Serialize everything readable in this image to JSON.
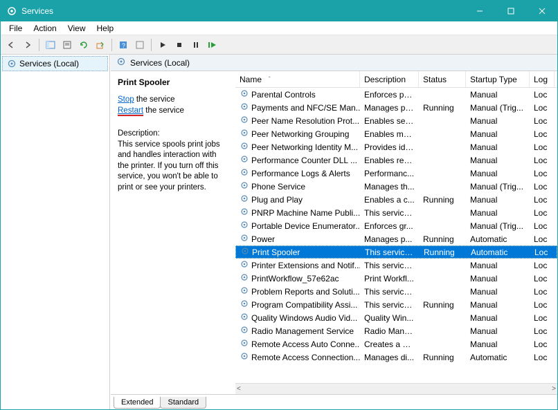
{
  "window": {
    "title": "Services"
  },
  "menubar": {
    "items": [
      "File",
      "Action",
      "View",
      "Help"
    ]
  },
  "tree": {
    "root": "Services (Local)"
  },
  "right_header": {
    "label": "Services (Local)"
  },
  "detail": {
    "title": "Print Spooler",
    "stop_link": "Stop",
    "stop_suffix": " the service",
    "restart_link": "Restart",
    "restart_suffix": " the service",
    "desc_label": "Description:",
    "desc_body": "This service spools print jobs and handles interaction with the printer. If you turn off this service, you won't be able to print or see your printers."
  },
  "columns": {
    "name": "Name",
    "desc": "Description",
    "status": "Status",
    "startup": "Startup Type",
    "log": "Log"
  },
  "rows": [
    {
      "name": "Parental Controls",
      "desc": "Enforces pa...",
      "status": "",
      "startup": "Manual",
      "log": "Loc"
    },
    {
      "name": "Payments and NFC/SE Man...",
      "desc": "Manages pa...",
      "status": "Running",
      "startup": "Manual (Trig...",
      "log": "Loc"
    },
    {
      "name": "Peer Name Resolution Prot...",
      "desc": "Enables serv...",
      "status": "",
      "startup": "Manual",
      "log": "Loc"
    },
    {
      "name": "Peer Networking Grouping",
      "desc": "Enables mul...",
      "status": "",
      "startup": "Manual",
      "log": "Loc"
    },
    {
      "name": "Peer Networking Identity M...",
      "desc": "Provides ide...",
      "status": "",
      "startup": "Manual",
      "log": "Loc"
    },
    {
      "name": "Performance Counter DLL ...",
      "desc": "Enables rem...",
      "status": "",
      "startup": "Manual",
      "log": "Loc"
    },
    {
      "name": "Performance Logs & Alerts",
      "desc": "Performanc...",
      "status": "",
      "startup": "Manual",
      "log": "Loc"
    },
    {
      "name": "Phone Service",
      "desc": "Manages th...",
      "status": "",
      "startup": "Manual (Trig...",
      "log": "Loc"
    },
    {
      "name": "Plug and Play",
      "desc": "Enables a c...",
      "status": "Running",
      "startup": "Manual",
      "log": "Loc"
    },
    {
      "name": "PNRP Machine Name Publi...",
      "desc": "This service ...",
      "status": "",
      "startup": "Manual",
      "log": "Loc"
    },
    {
      "name": "Portable Device Enumerator...",
      "desc": "Enforces gr...",
      "status": "",
      "startup": "Manual (Trig...",
      "log": "Loc"
    },
    {
      "name": "Power",
      "desc": "Manages p...",
      "status": "Running",
      "startup": "Automatic",
      "log": "Loc"
    },
    {
      "name": "Print Spooler",
      "desc": "This service ...",
      "status": "Running",
      "startup": "Automatic",
      "log": "Loc",
      "selected": true
    },
    {
      "name": "Printer Extensions and Notif...",
      "desc": "This service ...",
      "status": "",
      "startup": "Manual",
      "log": "Loc"
    },
    {
      "name": "PrintWorkflow_57e62ac",
      "desc": "Print Workfl...",
      "status": "",
      "startup": "Manual",
      "log": "Loc"
    },
    {
      "name": "Problem Reports and Soluti...",
      "desc": "This service ...",
      "status": "",
      "startup": "Manual",
      "log": "Loc"
    },
    {
      "name": "Program Compatibility Assi...",
      "desc": "This service ...",
      "status": "Running",
      "startup": "Manual",
      "log": "Loc"
    },
    {
      "name": "Quality Windows Audio Vid...",
      "desc": "Quality Win...",
      "status": "",
      "startup": "Manual",
      "log": "Loc"
    },
    {
      "name": "Radio Management Service",
      "desc": "Radio Mana...",
      "status": "",
      "startup": "Manual",
      "log": "Loc"
    },
    {
      "name": "Remote Access Auto Conne...",
      "desc": "Creates a co...",
      "status": "",
      "startup": "Manual",
      "log": "Loc"
    },
    {
      "name": "Remote Access Connection...",
      "desc": "Manages di...",
      "status": "Running",
      "startup": "Automatic",
      "log": "Loc"
    }
  ],
  "tabs": {
    "extended": "Extended",
    "standard": "Standard"
  }
}
